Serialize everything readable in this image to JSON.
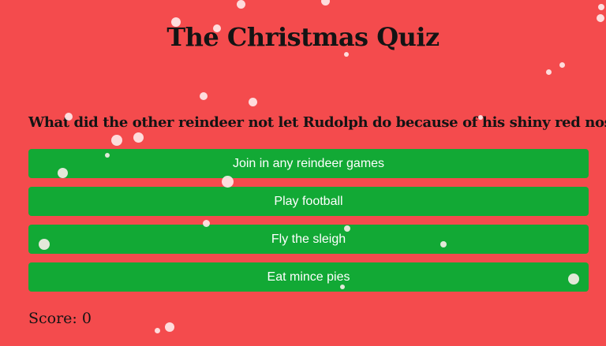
{
  "page": {
    "title": "The Christmas Quiz"
  },
  "quiz": {
    "question": "What did the other reindeer not let Rudolph do because of his shiny red nose?",
    "answers": [
      {
        "label": "Join in any reindeer games"
      },
      {
        "label": "Play football"
      },
      {
        "label": "Fly the sleigh"
      },
      {
        "label": "Eat mince pies"
      }
    ],
    "score_label": "Score: 0"
  },
  "colors": {
    "background": "#f44b4d",
    "answer_button": "#12a935",
    "answer_text": "#ffffff",
    "heading_text": "#141414",
    "snowflake": "#fff0f0"
  }
}
